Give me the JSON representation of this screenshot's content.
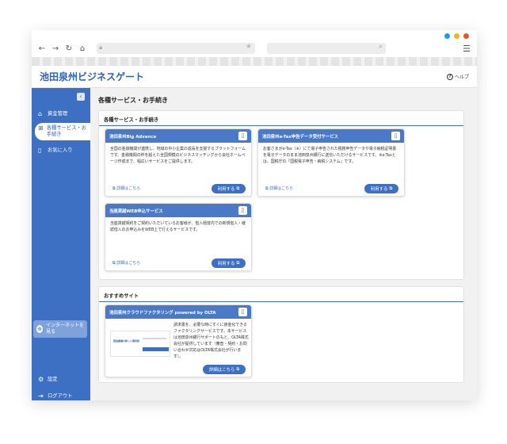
{
  "colors": {
    "accent": "#3d70c2",
    "dot_blue": "#1e9af0",
    "dot_yellow": "#f5b21b",
    "dot_red": "#e8532a"
  },
  "browser": {
    "icons": [
      "back-arrow-icon",
      "forward-arrow-icon",
      "reload-icon",
      "home-icon",
      "lock-icon",
      "star-icon",
      "search-icon",
      "hamburger-menu-icon"
    ]
  },
  "header": {
    "title": "池田泉州ビジネスゲート",
    "help_label": "ヘルプ"
  },
  "sidebar": {
    "items": [
      {
        "label": "資金管理",
        "icon": "home-icon"
      },
      {
        "label": "各種サービス・お手続き",
        "icon": "grid-icon"
      },
      {
        "label": "お気に入り",
        "icon": "bookmark-icon"
      }
    ],
    "internet_button": "インターネットを見る",
    "settings": "設定",
    "logout": "ログアウト"
  },
  "main": {
    "page_title": "各種サービス・お手続き",
    "section1_title": "各種サービス・お手続き",
    "section2_title": "おすすめサイト",
    "detail_label": "詳細はこちら",
    "use_label": "利用する",
    "cards": [
      {
        "title": "池田泉州Big Advance",
        "desc": "全国の金融機関が連携し、地域の中小企業の成長を支援するプラットフォームです。金融機関の枠を超えた全国規模のビジネスマッチングから会社ホームページ作成まで、幅広いサービスをご提供します。"
      },
      {
        "title": "池田泉州e-Tax申告データ受付サービス",
        "desc": "お客さまがe-Tax（※）にて電子申告された税務申告データや電子納税証明書を電子データのまま池田泉州銀行に送信いただけるサービスです。※e-Taxとは、国税庁の「国税電子申告・納税システム」です。"
      },
      {
        "title": "当座貸越WEB申込サービス",
        "desc": "当座貸越契約をご契約いただいているお客様が、借入極度内での新規借入・継続借入のお申込みをWEB上で行えるサービスです。"
      }
    ],
    "recommend": {
      "title": "池田泉州クラウドファクタリング powered by OLTA",
      "desc": "請求書を、必要な時にすぐに資金化できるファクタリングサービスです。本サービスは池田泉州銀行サポートのもと、OLTA株式会社が提供しています（審査・契約・お問い合わせ対応はOLTA株式会社が行います）。",
      "button": "詳細はこちら",
      "thumb_text": "資金調達の新しい選択肢"
    }
  }
}
